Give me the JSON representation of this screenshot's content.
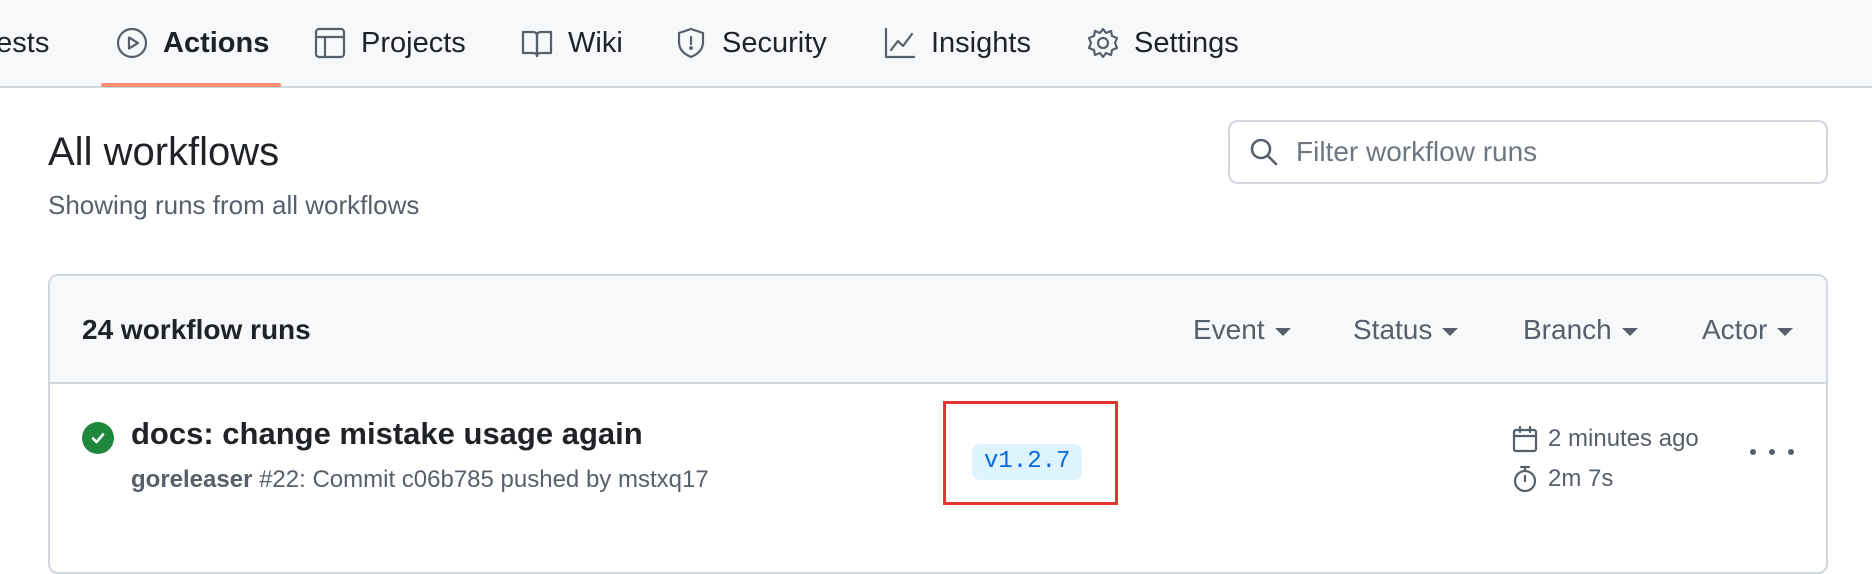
{
  "tabs": [
    {
      "label": "uests",
      "icon": "pull-request-icon"
    },
    {
      "label": "Actions",
      "icon": "play-icon",
      "active": true
    },
    {
      "label": "Projects",
      "icon": "table-icon"
    },
    {
      "label": "Wiki",
      "icon": "book-icon"
    },
    {
      "label": "Security",
      "icon": "shield-icon"
    },
    {
      "label": "Insights",
      "icon": "graph-icon"
    },
    {
      "label": "Settings",
      "icon": "gear-icon"
    }
  ],
  "page": {
    "title": "All workflows",
    "subtitle": "Showing runs from all workflows"
  },
  "filter": {
    "placeholder": "Filter workflow runs"
  },
  "runs": {
    "count_label": "24 workflow runs",
    "filters": [
      "Event",
      "Status",
      "Branch",
      "Actor"
    ],
    "items": [
      {
        "title": "docs: change mistake usage again",
        "workflow": "goreleaser",
        "detail": "#22: Commit c06b785 pushed by mstxq17",
        "branch": "v1.2.7",
        "time": "2 minutes ago",
        "duration": "2m 7s",
        "status": "success"
      }
    ]
  },
  "colors": {
    "accent_underline": "#fd8c73",
    "success": "#1f883d",
    "branch_bg": "#ddf4ff",
    "branch_text": "#0969da",
    "highlight_box": "#e5342f"
  }
}
